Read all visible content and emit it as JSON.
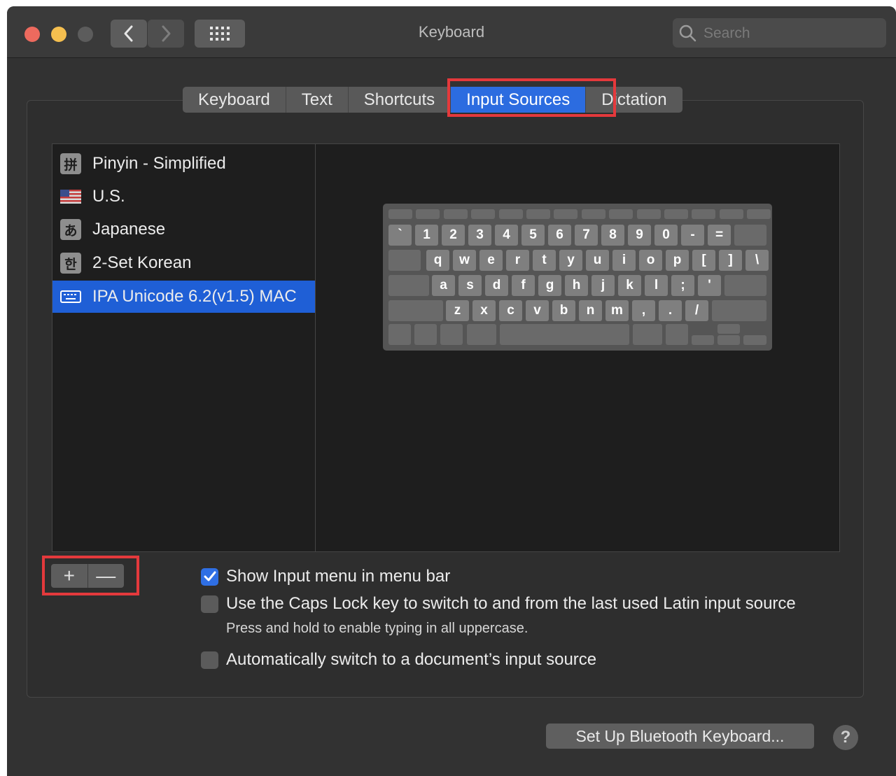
{
  "window": {
    "title": "Keyboard",
    "search_placeholder": "Search",
    "icons": {
      "back": "chevron-left-icon",
      "forward": "chevron-right-icon",
      "show_all": "grid-icon",
      "search": "search-icon"
    }
  },
  "tabs": [
    {
      "label": "Keyboard"
    },
    {
      "label": "Text"
    },
    {
      "label": "Shortcuts"
    },
    {
      "label": "Input Sources",
      "active": true
    },
    {
      "label": "Dictation"
    }
  ],
  "input_sources": [
    {
      "label": "Pinyin - Simplified",
      "icon_text": "拼"
    },
    {
      "label": "U.S.",
      "icon": "us-flag-icon"
    },
    {
      "label": "Japanese",
      "icon_text": "あ"
    },
    {
      "label": "2-Set Korean",
      "icon_text": "한"
    },
    {
      "label": "IPA Unicode 6.2(v1.5) MAC",
      "icon": "keyboard-icon",
      "selected": true
    }
  ],
  "keyboard_rows": [
    [
      "`",
      "1",
      "2",
      "3",
      "4",
      "5",
      "6",
      "7",
      "8",
      "9",
      "0",
      "-",
      "="
    ],
    [
      "q",
      "w",
      "e",
      "r",
      "t",
      "y",
      "u",
      "i",
      "o",
      "p",
      "[",
      "]",
      "\\"
    ],
    [
      "a",
      "s",
      "d",
      "f",
      "g",
      "h",
      "j",
      "k",
      "l",
      ";",
      "'"
    ],
    [
      "z",
      "x",
      "c",
      "v",
      "b",
      "n",
      "m",
      ",",
      ".",
      "/"
    ]
  ],
  "list_controls": {
    "add": "+",
    "remove": "—"
  },
  "options": {
    "show_input_menu": {
      "label": "Show Input menu in menu bar",
      "checked": true
    },
    "caps_lock_switch": {
      "label": "Use the Caps Lock key to switch to and from the last used Latin input source",
      "checked": false
    },
    "caps_lock_hint": "Press and hold to enable typing in all uppercase.",
    "auto_switch": {
      "label": "Automatically switch to a document’s input source",
      "checked": false
    }
  },
  "footer": {
    "bluetooth_button": "Set Up Bluetooth Keyboard...",
    "help_button": "?"
  },
  "colors": {
    "accent": "#2c6ce0",
    "highlight": "#e4393c",
    "window_bg": "#323232"
  }
}
